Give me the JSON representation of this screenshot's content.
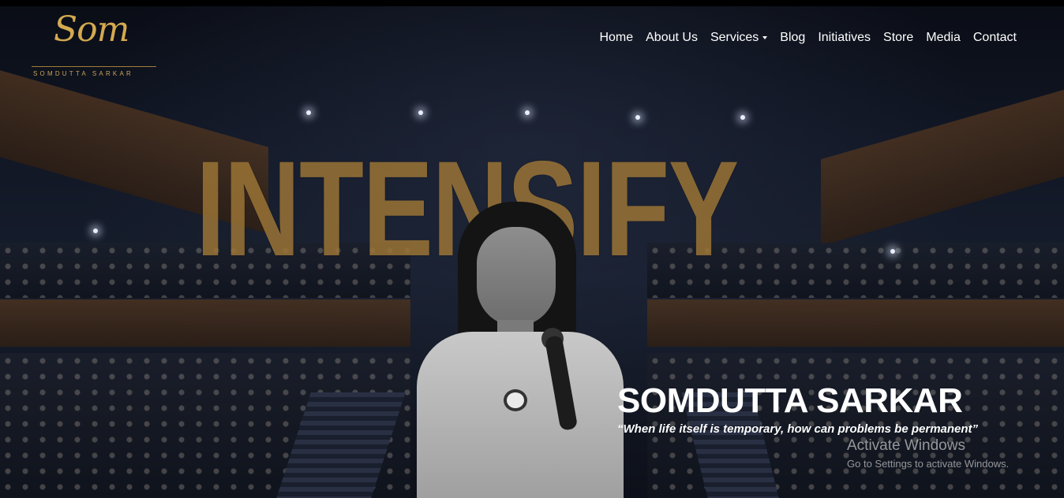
{
  "header": {
    "logo_script": "Som",
    "logo_subtitle": "SOMDUTTA SARKAR",
    "nav": [
      {
        "label": "Home"
      },
      {
        "label": "About Us"
      },
      {
        "label": "Services",
        "has_dropdown": true
      },
      {
        "label": "Blog"
      },
      {
        "label": "Initiatives"
      },
      {
        "label": "Store"
      },
      {
        "label": "Media"
      },
      {
        "label": "Contact"
      }
    ]
  },
  "hero": {
    "headline": "INTENSIFY",
    "name": "SOMDUTTA SARKAR",
    "quote": "“When life itself is temporary, how can problems be permanent”"
  },
  "os_overlay": {
    "title": "Activate Windows",
    "subtitle": "Go to Settings to activate Windows."
  },
  "colors": {
    "gold": "#a87e3a",
    "logo_gold": "#d4a950",
    "nav_text": "#ffffff",
    "background": "#0a0d16"
  }
}
